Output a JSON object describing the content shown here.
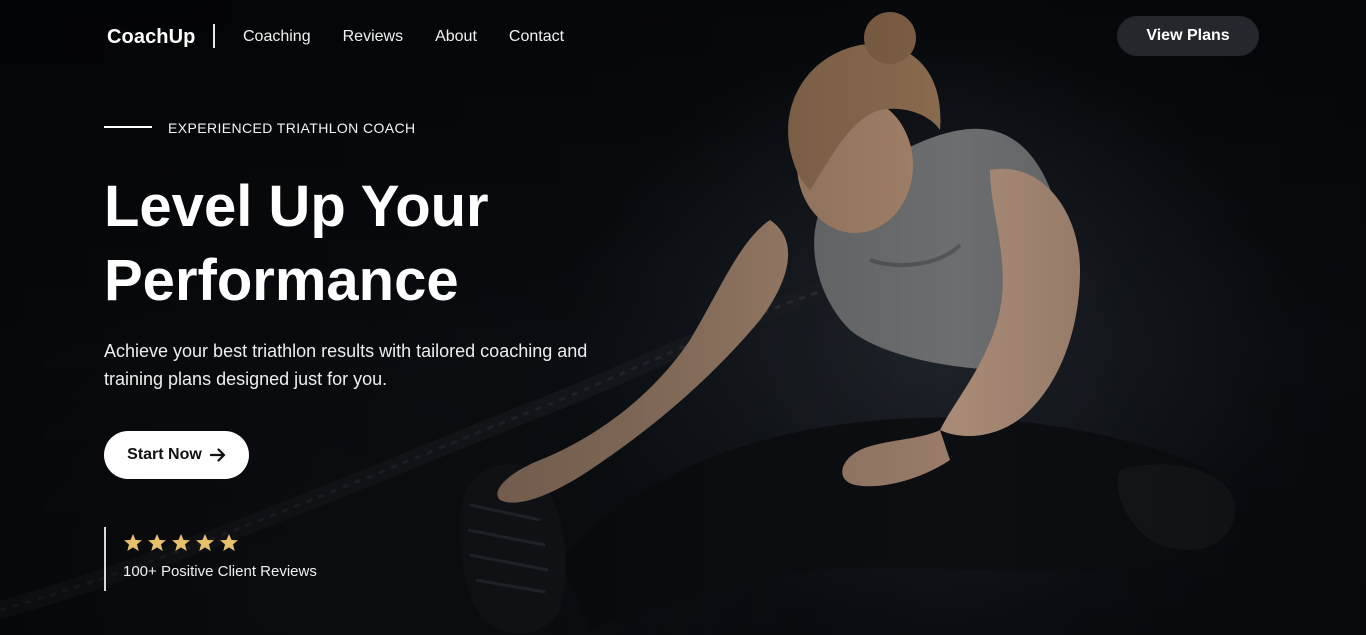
{
  "header": {
    "logo": "CoachUp",
    "nav": [
      "Coaching",
      "Reviews",
      "About",
      "Contact"
    ],
    "cta": "View Plans"
  },
  "hero": {
    "eyebrow": "EXPERIENCED TRIATHLON COACH",
    "headline_line1": "Level Up Your",
    "headline_line2": "Performance",
    "subtext": "Achieve your best triathlon results with tailored coaching and training plans designed just for you.",
    "button": "Start Now",
    "button_icon": "arrow-right-icon",
    "rating": 5,
    "reviews_text": "100+ Positive Client Reviews"
  },
  "colors": {
    "background": "#07090c",
    "button_dark": "#24272c",
    "star": "#e7c06a",
    "text": "#ffffff"
  }
}
